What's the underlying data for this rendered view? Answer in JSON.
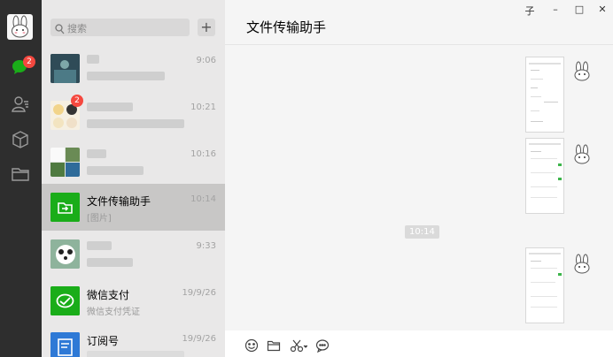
{
  "app": {
    "accent": "#1aad19",
    "badge_color": "#f5483f"
  },
  "sidebar": {
    "chat_badge": "2"
  },
  "search": {
    "placeholder": "搜索",
    "add_label": "+"
  },
  "chats": [
    {
      "name": "",
      "message": "",
      "time": "9:06"
    },
    {
      "name": "",
      "message": "",
      "time": "10:21",
      "badge": "2"
    },
    {
      "name": "",
      "message": "",
      "time": "10:16"
    },
    {
      "name": "文件传输助手",
      "message": "[图片]",
      "time": "10:14"
    },
    {
      "name": "",
      "message": "",
      "time": "9:33"
    },
    {
      "name": "微信支付",
      "message": "微信支付凭证",
      "time": "19/9/26"
    },
    {
      "name": "订阅号",
      "message": "",
      "time": "19/9/26"
    }
  ],
  "window_controls": {
    "pin": "子",
    "minimize": "–",
    "maximize": "□",
    "close": "✕"
  },
  "chat": {
    "title": "文件传输助手",
    "timestamp": "10:14"
  }
}
